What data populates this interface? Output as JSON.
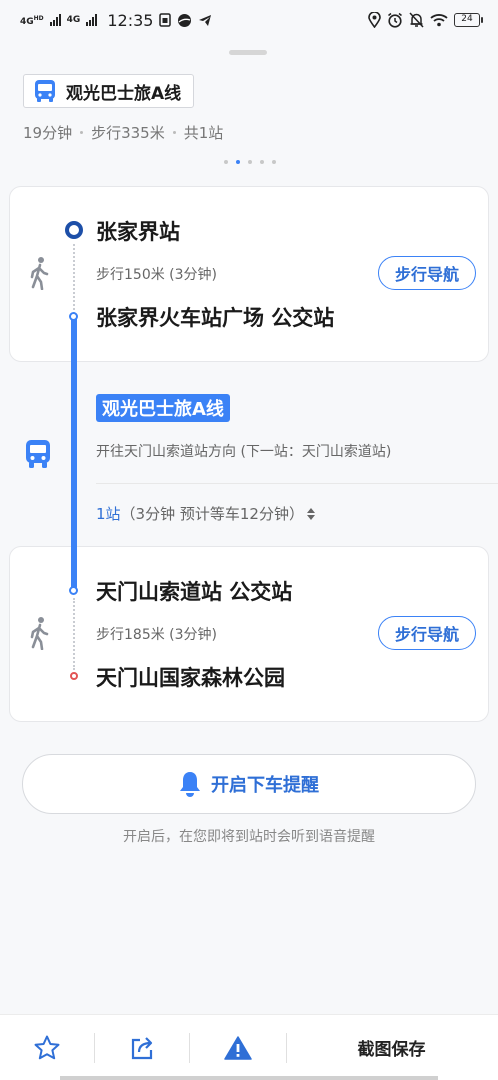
{
  "status_bar": {
    "net1": "4G",
    "net1_sup": "HD",
    "net2": "4G",
    "time": "12:35",
    "battery": "24",
    "icons": [
      "sim-card-icon",
      "browser-icon",
      "telegram-icon",
      "location-icon",
      "alarm-icon",
      "mute-icon",
      "wifi-icon",
      "battery-icon"
    ]
  },
  "route": {
    "name": "观光巴士旅A线",
    "duration": "19分钟",
    "walk": "步行335米",
    "stops_total": "共1站",
    "page_count": 5,
    "active_page": 2
  },
  "segments": {
    "start": {
      "station": "张家界站",
      "walk_info": "步行150米 (3分钟)",
      "nav_label": "步行导航",
      "board_stop": "张家界火车站广场 公交站"
    },
    "bus": {
      "line_label": "观光巴士旅A线",
      "direction": "开往天门山索道站方向 (下一站：天门山索道站)",
      "stops_count": "1站",
      "stops_detail": "（3分钟 预计等车12分钟）",
      "expand_icon": "sort-arrows-icon"
    },
    "end": {
      "alight_stop": "天门山索道站 公交站",
      "walk_info": "步行185米 (3分钟)",
      "nav_label": "步行导航",
      "destination": "天门山国家森林公园"
    }
  },
  "reminder": {
    "button_label": "开启下车提醒",
    "hint": "开启后，在您即将到站时会听到语音提醒"
  },
  "bottom_bar": {
    "save_label": "截图保存"
  },
  "colors": {
    "accent": "#3b82f6",
    "accent_dark": "#1d4fa8",
    "end_marker": "#e25555"
  }
}
